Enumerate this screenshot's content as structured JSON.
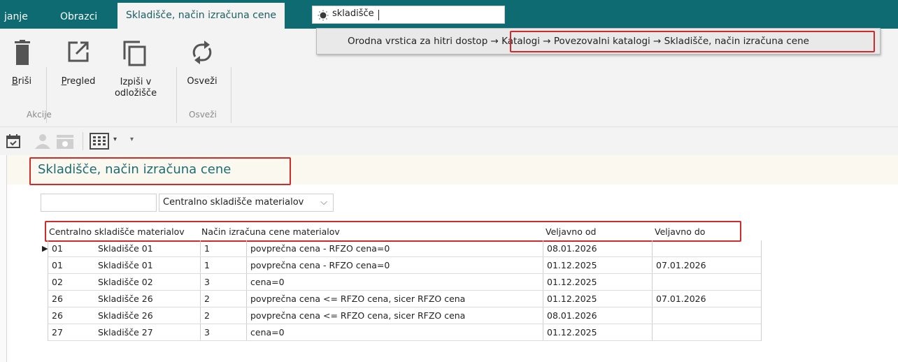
{
  "topbar": {
    "tabs": [
      {
        "label": "janje"
      },
      {
        "label": "Obrazci"
      },
      {
        "label": "Skladišče, način izračuna cene"
      }
    ],
    "search": {
      "value": "skladišče",
      "icon": "lightbulb-icon"
    }
  },
  "popup": {
    "path_prefix": "Orodna vrstica za hitri dostop →",
    "path_rest": "Katalogi → Povezovalni katalogi → Skladišče, način izračuna cene"
  },
  "ribbon": {
    "buttons": [
      {
        "label_u": "B",
        "label_rest": "riši",
        "icon": "trash-icon"
      },
      {
        "label_u": "P",
        "label_rest": "regled",
        "icon": "open-external-icon"
      },
      {
        "label_line1": "Izpiši v",
        "label_line2": "odložišče",
        "icon": "copy-icon"
      },
      {
        "label": "Osveži",
        "icon": "refresh-icon"
      }
    ],
    "groups": [
      "Akcije",
      "Osveži"
    ]
  },
  "page": {
    "title": "Skladišče, način izračuna cene",
    "filter_select": "Centralno skladišče materialov"
  },
  "grid": {
    "headers": [
      "Centralno skladišče materialov",
      "Način izračuna cene materialov",
      "Veljavno od",
      "Veljavno do"
    ],
    "rows": [
      {
        "code": "01",
        "name": "Skladišče 01",
        "mcode": "1",
        "method": "povprečna cena -  RFZO cena=0",
        "from": "08.01.2026",
        "to": ""
      },
      {
        "code": "01",
        "name": "Skladišče 01",
        "mcode": "1",
        "method": "povprečna cena -  RFZO cena=0",
        "from": "01.12.2025",
        "to": "07.01.2026"
      },
      {
        "code": "02",
        "name": "Skladišče 02",
        "mcode": "3",
        "method": "cena=0",
        "from": "01.12.2025",
        "to": ""
      },
      {
        "code": "26",
        "name": "Skladišče 26",
        "mcode": "2",
        "method": "povprečna cena <= RFZO cena, sicer RFZO cena",
        "from": "01.12.2025",
        "to": "07.01.2026"
      },
      {
        "code": "26",
        "name": "Skladišče 26",
        "mcode": "2",
        "method": "povprečna cena <= RFZO cena, sicer RFZO cena",
        "from": "08.01.2026",
        "to": ""
      },
      {
        "code": "27",
        "name": "Skladišče 27",
        "mcode": "3",
        "method": "cena=0",
        "from": "01.12.2025",
        "to": ""
      }
    ]
  },
  "colors": {
    "topbar": "#0e6b72",
    "accent_text": "#1d6b73",
    "highlight": "#d22a2a"
  }
}
